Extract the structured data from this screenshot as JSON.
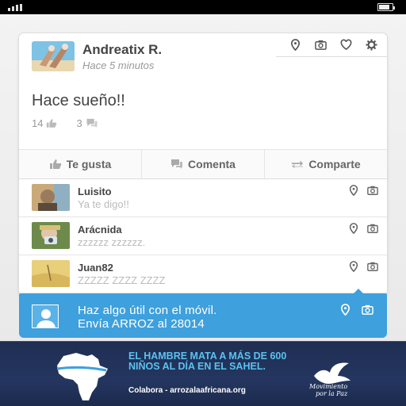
{
  "post": {
    "author": "Andreatix R.",
    "time": "Hace 5 minutos",
    "text": "Hace sueño!!",
    "likes": "14",
    "comments": "3"
  },
  "actions": {
    "like": "Te gusta",
    "comment": "Comenta",
    "share": "Comparte"
  },
  "comments": [
    {
      "name": "Luisito",
      "text": "Ya te digo!!"
    },
    {
      "name": "Arácnida",
      "text": "zzzzzz zzzzzz."
    },
    {
      "name": "Juan82",
      "text": "ZZZZZ ZZZZ ZZZZ"
    }
  ],
  "compose": {
    "line1": "Haz algo útil con el móvil.",
    "line2": "Envía ARROZ al 28014"
  },
  "banner": {
    "headline": "EL HAMBRE MATA A MÁS DE 600 NIÑOS AL DÍA EN EL SAHEL.",
    "sub": "Colabora - arrozalaafricana.org",
    "logo_line1": "Movimiento",
    "logo_line2": "por la Paz"
  },
  "colors": {
    "accent": "#3ea0dc",
    "banner_bg": "#243660",
    "headline": "#5ac2f0"
  },
  "icons": [
    "pin-icon",
    "camera-icon",
    "heart-icon",
    "gear-icon",
    "thumbs-up-icon",
    "speech-bubble-icon",
    "share-arrows-icon",
    "user-silhouette-icon",
    "africa-map-icon",
    "dove-icon"
  ]
}
